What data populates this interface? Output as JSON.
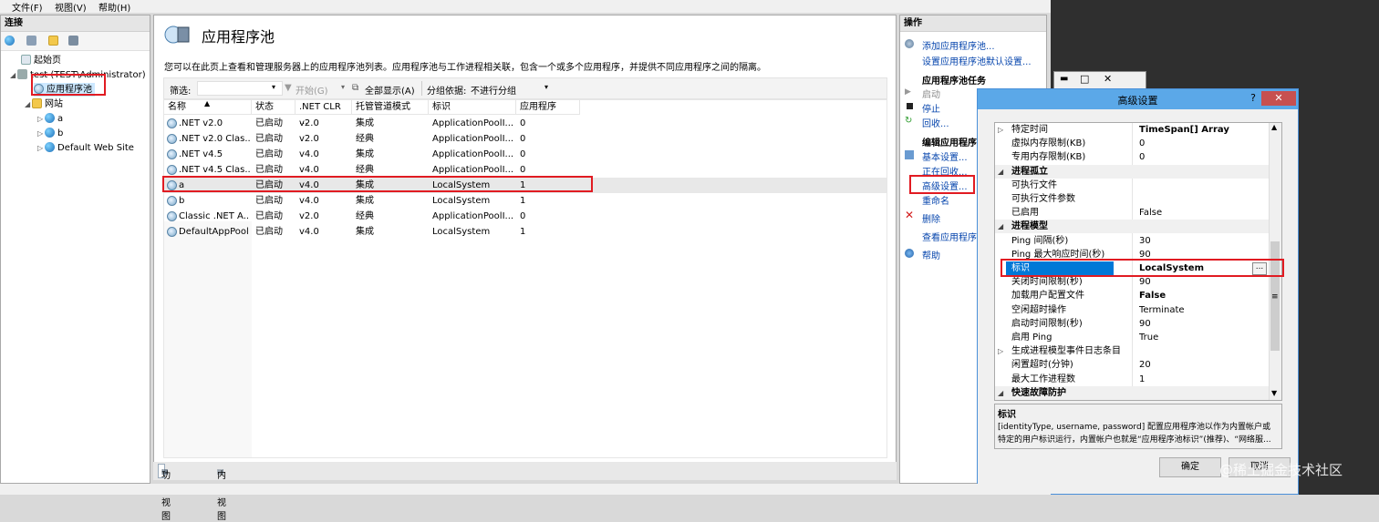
{
  "menu": [
    "文件(F)",
    "视图(V)",
    "帮助(H)"
  ],
  "connections": {
    "header": "连接",
    "tree": [
      {
        "label": "起始页",
        "icon": "start-page-icon"
      },
      {
        "label": "test (TEST\\Administrator)",
        "icon": "server-icon"
      },
      {
        "label": "应用程序池",
        "icon": "app-pool-icon",
        "selected": true
      },
      {
        "label": "网站",
        "icon": "folder-icon"
      },
      {
        "label": "a",
        "icon": "globe-icon"
      },
      {
        "label": "b",
        "icon": "globe-icon"
      },
      {
        "label": "Default Web Site",
        "icon": "globe-icon"
      }
    ]
  },
  "center": {
    "title": "应用程序池",
    "description": "您可以在此页上查看和管理服务器上的应用程序池列表。应用程序池与工作进程相关联，包含一个或多个应用程序，并提供不同应用程序之间的隔离。",
    "filter": {
      "label": "筛选:",
      "start": "开始(G)",
      "show_all": "全部显示(A)",
      "group_by_label": "分组依据:",
      "group_by_value": "不进行分组"
    },
    "columns": [
      "名称",
      "状态",
      ".NET CLR ...",
      "托管管道模式",
      "标识",
      "应用程序"
    ],
    "rows": [
      {
        "name": ".NET v2.0",
        "status": "已启动",
        "clr": "v2.0",
        "mode": "集成",
        "identity": "ApplicationPoolI...",
        "apps": "0"
      },
      {
        "name": ".NET v2.0 Clas...",
        "status": "已启动",
        "clr": "v2.0",
        "mode": "经典",
        "identity": "ApplicationPoolI...",
        "apps": "0"
      },
      {
        "name": ".NET v4.5",
        "status": "已启动",
        "clr": "v4.0",
        "mode": "集成",
        "identity": "ApplicationPoolI...",
        "apps": "0"
      },
      {
        "name": ".NET v4.5 Clas...",
        "status": "已启动",
        "clr": "v4.0",
        "mode": "经典",
        "identity": "ApplicationPoolI...",
        "apps": "0"
      },
      {
        "name": "a",
        "status": "已启动",
        "clr": "v4.0",
        "mode": "集成",
        "identity": "LocalSystem",
        "apps": "1"
      },
      {
        "name": "b",
        "status": "已启动",
        "clr": "v4.0",
        "mode": "集成",
        "identity": "LocalSystem",
        "apps": "1"
      },
      {
        "name": "Classic .NET A...",
        "status": "已启动",
        "clr": "v2.0",
        "mode": "经典",
        "identity": "ApplicationPoolI...",
        "apps": "0"
      },
      {
        "name": "DefaultAppPool",
        "status": "已启动",
        "clr": "v4.0",
        "mode": "集成",
        "identity": "LocalSystem",
        "apps": "1"
      }
    ],
    "view_tabs": [
      "功能视图",
      "内容视图"
    ]
  },
  "actions": {
    "header": "操作",
    "items": [
      {
        "label": "添加应用程序池...",
        "kind": "link"
      },
      {
        "label": "设置应用程序池默认设置...",
        "kind": "link"
      },
      {
        "label": "应用程序池任务",
        "kind": "bold"
      },
      {
        "label": "启动",
        "kind": "gray"
      },
      {
        "label": "停止",
        "kind": "link"
      },
      {
        "label": "回收...",
        "kind": "link"
      },
      {
        "label": "编辑应用程序池",
        "kind": "bold"
      },
      {
        "label": "基本设置...",
        "kind": "link"
      },
      {
        "label": "正在回收...",
        "kind": "link"
      },
      {
        "label": "高级设置...",
        "kind": "link"
      },
      {
        "label": "重命名",
        "kind": "link"
      },
      {
        "label": "删除",
        "kind": "link"
      },
      {
        "label": "查看应用程序池",
        "kind": "link"
      },
      {
        "label": "帮助",
        "kind": "link"
      }
    ]
  },
  "dialog": {
    "title": "高级设置",
    "help_label": "?",
    "close_label": "✕",
    "properties": [
      {
        "key": "特定时间",
        "value": "TimeSpan[] Array",
        "bold_value": true,
        "expander": "▷"
      },
      {
        "key": "虚拟内存限制(KB)",
        "value": "0"
      },
      {
        "key": "专用内存限制(KB)",
        "value": "0"
      },
      {
        "key": "进程孤立",
        "value": "",
        "category": true,
        "expander": "◢"
      },
      {
        "key": "可执行文件",
        "value": ""
      },
      {
        "key": "可执行文件参数",
        "value": ""
      },
      {
        "key": "已启用",
        "value": "False"
      },
      {
        "key": "进程模型",
        "value": "",
        "category": true,
        "expander": "◢"
      },
      {
        "key": "Ping 间隔(秒)",
        "value": "30"
      },
      {
        "key": "Ping 最大响应时间(秒)",
        "value": "90"
      },
      {
        "key": "标识",
        "value": "LocalSystem",
        "selected": true,
        "bold_value": true
      },
      {
        "key": "关闭时间限制(秒)",
        "value": "90"
      },
      {
        "key": "加载用户配置文件",
        "value": "False",
        "bold_value": true
      },
      {
        "key": "空闲超时操作",
        "value": "Terminate"
      },
      {
        "key": "启动时间限制(秒)",
        "value": "90"
      },
      {
        "key": "启用 Ping",
        "value": "True"
      },
      {
        "key": "生成进程模型事件日志条目",
        "value": "",
        "expander": "▷"
      },
      {
        "key": "闲置超时(分钟)",
        "value": "20"
      },
      {
        "key": "最大工作进程数",
        "value": "1"
      },
      {
        "key": "快速故障防护",
        "value": "",
        "category": true,
        "expander": "◢"
      }
    ],
    "desc_title": "标识",
    "desc_text_1": "[identityType, username, password] 配置应用程序池以作为内置帐户或",
    "desc_text_2": "特定的用户标识运行，内置帐户也就是“应用程序池标识”(推荐)、“网络服...",
    "ok_label": "确定",
    "cancel_label": "取消"
  },
  "watermark": "@稀土掘金技术社区"
}
